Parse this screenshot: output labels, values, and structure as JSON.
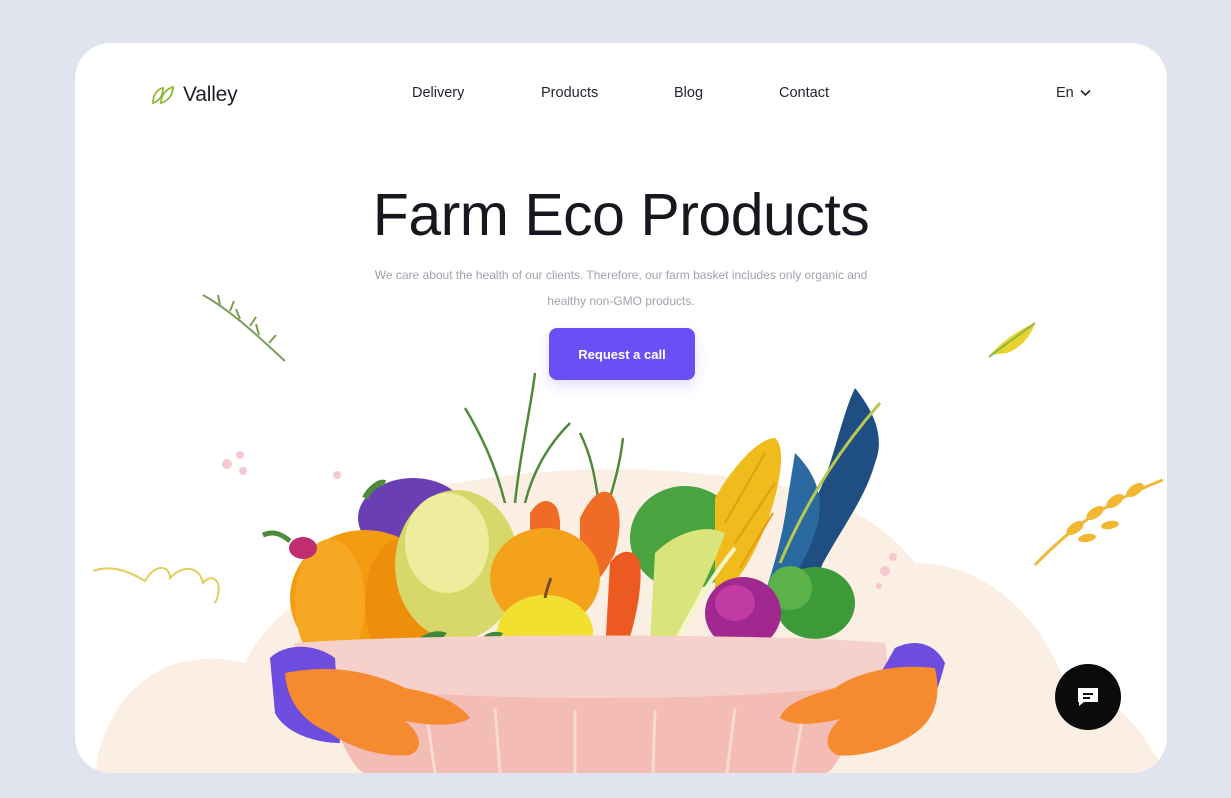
{
  "brand": {
    "name": "Valley",
    "icon": "leaf-icon",
    "accent": "#8fb935"
  },
  "nav": {
    "items": [
      {
        "label": "Delivery"
      },
      {
        "label": "Products"
      },
      {
        "label": "Blog"
      },
      {
        "label": "Contact"
      }
    ]
  },
  "language": {
    "label": "En",
    "icon": "chevron-down-icon"
  },
  "hero": {
    "title": "Farm Eco Products",
    "description": "We care about the health of our clients. Therefore, our farm basket includes only organic and healthy non-GMO products.",
    "cta_label": "Request a call",
    "cta_color": "#6b4ff5"
  },
  "chat": {
    "icon": "chat-icon"
  },
  "colors": {
    "page_bg": "#dfe4ee",
    "card_bg": "#ffffff"
  }
}
